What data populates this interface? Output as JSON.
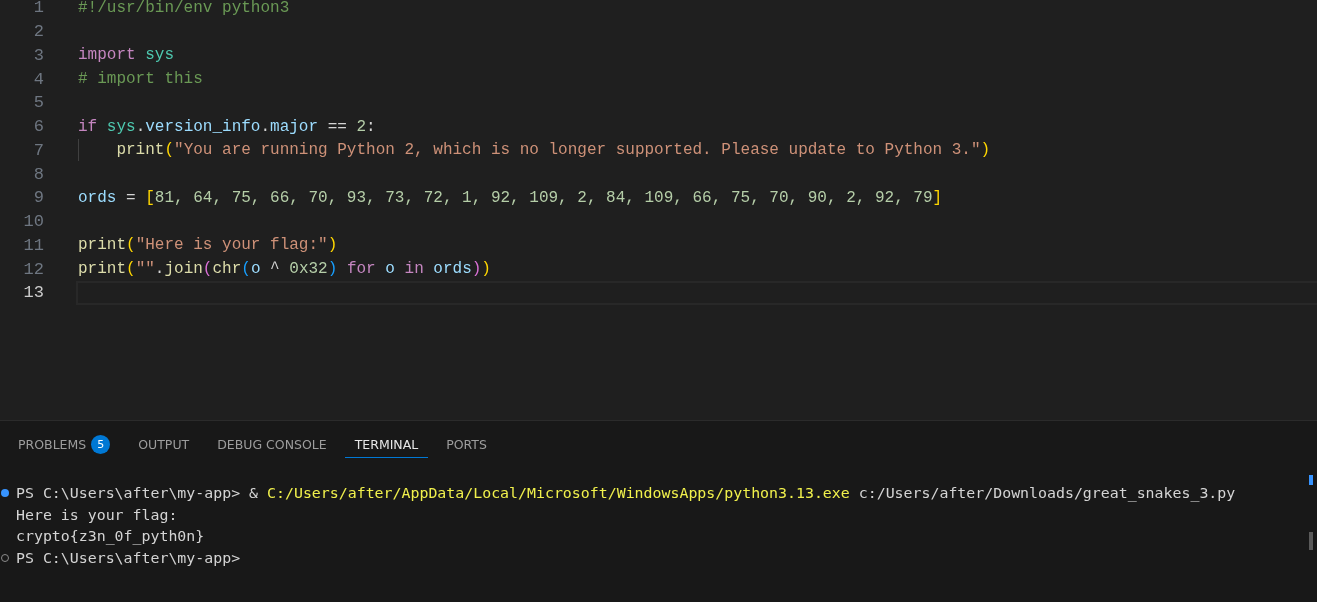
{
  "editor": {
    "lines": [
      {
        "number": "1",
        "current": false,
        "tokens": [
          {
            "text": "#!/usr/bin/env python3",
            "kind": "comment"
          }
        ]
      },
      {
        "number": "2",
        "current": false
      },
      {
        "number": "3",
        "current": false,
        "tokens": [
          {
            "text": "import ",
            "kind": "keyword"
          },
          {
            "text": "sys",
            "kind": "module"
          }
        ]
      },
      {
        "number": "4",
        "current": false,
        "tokens": [
          {
            "text": "# import this",
            "kind": "comment"
          }
        ]
      },
      {
        "number": "5",
        "current": false
      },
      {
        "number": "6",
        "current": false,
        "tokens": [
          {
            "text": "if ",
            "kind": "keyword"
          },
          {
            "text": "sys",
            "kind": "module"
          },
          {
            "text": ".",
            "kind": "plain"
          },
          {
            "text": "version_info",
            "kind": "variable"
          },
          {
            "text": ".",
            "kind": "plain"
          },
          {
            "text": "major",
            "kind": "variable"
          },
          {
            "text": " == ",
            "kind": "plain"
          },
          {
            "text": "2",
            "kind": "number"
          },
          {
            "text": ":",
            "kind": "plain"
          }
        ]
      },
      {
        "number": "7",
        "current": false,
        "indent_guide": true,
        "tokens": [
          {
            "text": "    print",
            "kind": "function"
          },
          {
            "text": "(",
            "kind": "bracket1"
          },
          {
            "text": "\"You are running Python 2, which is no longer supported. Please update to Python 3.\"",
            "kind": "string"
          },
          {
            "text": ")",
            "kind": "bracket1"
          }
        ]
      },
      {
        "number": "8",
        "current": false
      },
      {
        "number": "9",
        "current": false,
        "tokens": [
          {
            "text": "ords",
            "kind": "variable"
          },
          {
            "text": " = ",
            "kind": "plain"
          },
          {
            "text": "[",
            "kind": "bracket1"
          },
          {
            "text": "81, 64, 75, 66, 70, 93, 73, 72, 1, 92, 109, 2, 84, 109, 66, 75, 70, 90, 2, 92, 79",
            "kind": "number"
          },
          {
            "text": "]",
            "kind": "bracket1"
          }
        ]
      },
      {
        "number": "10",
        "current": false
      },
      {
        "number": "11",
        "current": false,
        "tokens": [
          {
            "text": "print",
            "kind": "function"
          },
          {
            "text": "(",
            "kind": "bracket1"
          },
          {
            "text": "\"Here is your flag:\"",
            "kind": "string"
          },
          {
            "text": ")",
            "kind": "bracket1"
          }
        ]
      },
      {
        "number": "12",
        "current": false,
        "tokens": [
          {
            "text": "print",
            "kind": "function"
          },
          {
            "text": "(",
            "kind": "bracket1"
          },
          {
            "text": "\"\"",
            "kind": "string"
          },
          {
            "text": ".",
            "kind": "plain"
          },
          {
            "text": "join",
            "kind": "function"
          },
          {
            "text": "(",
            "kind": "bracket2"
          },
          {
            "text": "chr",
            "kind": "function"
          },
          {
            "text": "(",
            "kind": "bracket3"
          },
          {
            "text": "o",
            "kind": "variable"
          },
          {
            "text": " ^ ",
            "kind": "plain"
          },
          {
            "text": "0x32",
            "kind": "number"
          },
          {
            "text": ")",
            "kind": "bracket3"
          },
          {
            "text": " for",
            "kind": "keyword"
          },
          {
            "text": " o ",
            "kind": "variable"
          },
          {
            "text": "in",
            "kind": "keyword"
          },
          {
            "text": " ords",
            "kind": "variable"
          },
          {
            "text": ")",
            "kind": "bracket2"
          },
          {
            "text": ")",
            "kind": "bracket1"
          }
        ]
      },
      {
        "number": "13",
        "current": true
      }
    ]
  },
  "panel": {
    "tabs": [
      {
        "label": "PROBLEMS",
        "badge": "5",
        "selected": false
      },
      {
        "label": "OUTPUT",
        "selected": false
      },
      {
        "label": "DEBUG CONSOLE",
        "selected": false
      },
      {
        "label": "TERMINAL",
        "selected": true
      },
      {
        "label": "PORTS",
        "selected": false
      }
    ],
    "terminal": {
      "lines": [
        {
          "marker": {
            "filled": true
          },
          "tokens": [
            {
              "text": "PS C:\\Users\\after\\my-app> & ",
              "kind": "plain"
            },
            {
              "text": "C:/Users/after/AppData/Local/Microsoft/WindowsApps/python3.13.exe",
              "kind": "path"
            },
            {
              "text": " c:/Users/after/Downloads/great_snakes_3.py",
              "kind": "plain"
            }
          ]
        },
        {
          "tokens": [
            {
              "text": "Here is your flag:",
              "kind": "plain"
            }
          ]
        },
        {
          "tokens": [
            {
              "text": "crypto{z3n_0f_pyth0n}",
              "kind": "plain"
            }
          ]
        },
        {
          "marker": {
            "filled": false
          },
          "tokens": [
            {
              "text": "PS C:\\Users\\after\\my-app>",
              "kind": "plain"
            }
          ]
        }
      ]
    }
  }
}
